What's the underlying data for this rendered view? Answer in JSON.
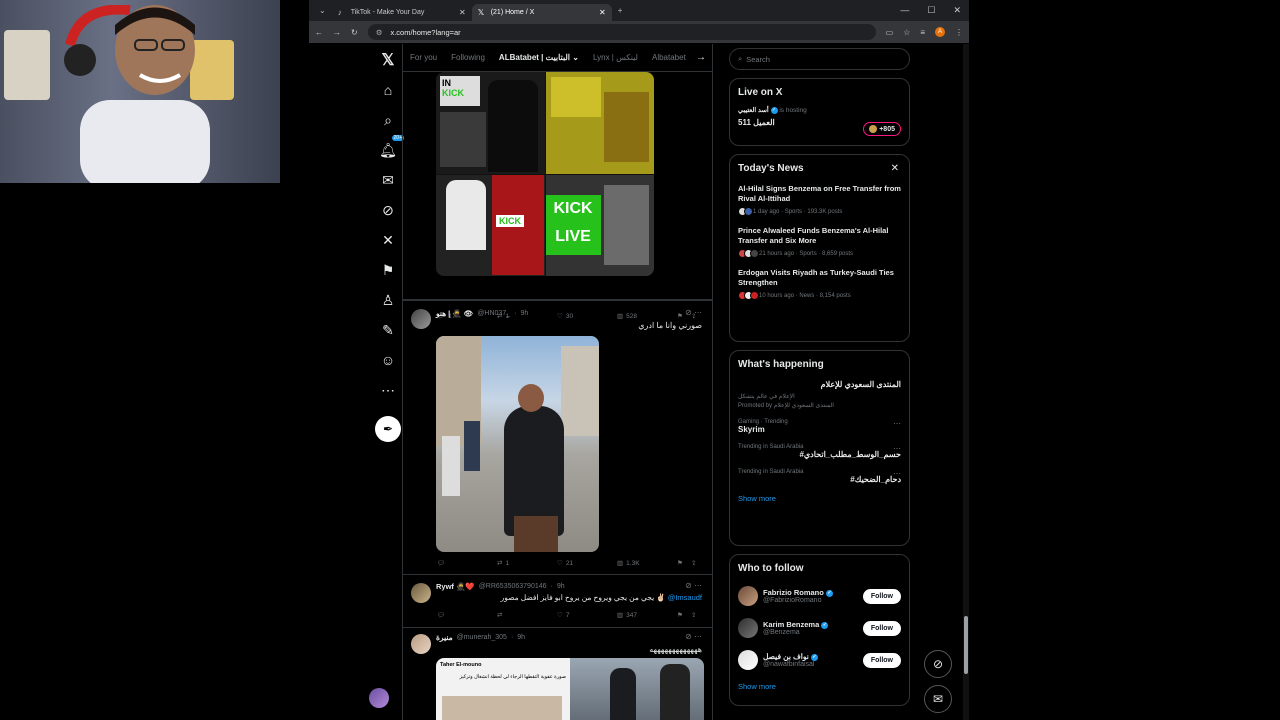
{
  "browser": {
    "tabs": [
      {
        "title": "TikTok - Make Your Day",
        "icon": "tiktok-icon"
      },
      {
        "title": "(21) Home / X",
        "icon": "x-logo-icon"
      }
    ],
    "url": "x.com/home?lang=ar",
    "profile_initial": "A"
  },
  "nav": {
    "notifications_badge": "20+"
  },
  "feed": {
    "tabs": [
      "For you",
      "Following",
      "ALBatabet | البتابيت",
      "Lynx | لينكس",
      "Albatabet"
    ],
    "selected_tab": 2,
    "posts": [
      {
        "stats": {
          "replies": "1",
          "reposts": "1",
          "likes": "30",
          "views": "528"
        }
      },
      {
        "name": "هنو | 🥷 👁",
        "handle": "@HN037_",
        "time": "9h",
        "text": "صورني وانا ما ادري",
        "stats": {
          "replies": "",
          "reposts": "1",
          "likes": "21",
          "views": "1.3K"
        }
      },
      {
        "name": "Rywf 🥷❤️",
        "handle": "@RR6535063790146",
        "time": "9h",
        "text": "يجي من يجي ويروح من يروح ابو فايز افضل مصور ✌🏻",
        "mention": "@Imsaudf",
        "stats": {
          "replies": "",
          "reposts": "",
          "likes": "7",
          "views": "347"
        }
      },
      {
        "name": "منيرة",
        "handle": "@munerah_305",
        "time": "9h",
        "text": "هههههههههههههه",
        "quoted_name": "Taher El-mouno",
        "quoted_text": "صورة عفوية التقطها الرجاء لي لحظة انشغال وتركيز"
      }
    ]
  },
  "right": {
    "search_placeholder": "Search",
    "live": {
      "title": "Live on X",
      "host": "أسد العتيبي",
      "hosting_label": "is hosting",
      "room": "العميل 511",
      "count": "+805"
    },
    "news": {
      "title": "Today's News",
      "items": [
        {
          "title": "Al-Hilal Signs Benzema on Free Transfer from Rival Al-Ittihad",
          "meta": "1 day ago · Sports · 193.3K posts"
        },
        {
          "title": "Prince Alwaleed Funds Benzema's Al-Hilal Transfer and Six More",
          "meta": "21 hours ago · Sports · 8,659 posts"
        },
        {
          "title": "Erdogan Visits Riyadh as Turkey-Saudi Ties Strengthen",
          "meta": "10 hours ago · News · 8,154 posts"
        }
      ]
    },
    "happening": {
      "title": "What's happening",
      "promoted_title": "المنتدى السعودي للإعلام",
      "promoted_sub": "الإعلام في عالم يتشكل",
      "promoted_by": "Promoted by المنتدى السعودي للإعلام",
      "trends": [
        {
          "meta": "Gaming · Trending",
          "name": "Skyrim"
        },
        {
          "meta": "Trending in Saudi Arabia",
          "name": "#حسم_الوسط_مطلب_اتحادي"
        },
        {
          "meta": "Trending in Saudi Arabia",
          "name": "#دحام_الضحيك"
        }
      ],
      "show_more": "Show more"
    },
    "follow": {
      "title": "Who to follow",
      "users": [
        {
          "name": "Fabrizio Romano",
          "handle": "@FabrizioRomano",
          "button": "Follow"
        },
        {
          "name": "Karim Benzema",
          "handle": "@Benzema",
          "button": "Follow"
        },
        {
          "name": "نواف بن فيصل",
          "handle": "@nawafbinfaisal",
          "button": "Follow"
        }
      ],
      "show_more": "Show more"
    }
  },
  "colors": {
    "accent": "#1d9bf0",
    "background": "#000000",
    "border": "#2f3336"
  }
}
